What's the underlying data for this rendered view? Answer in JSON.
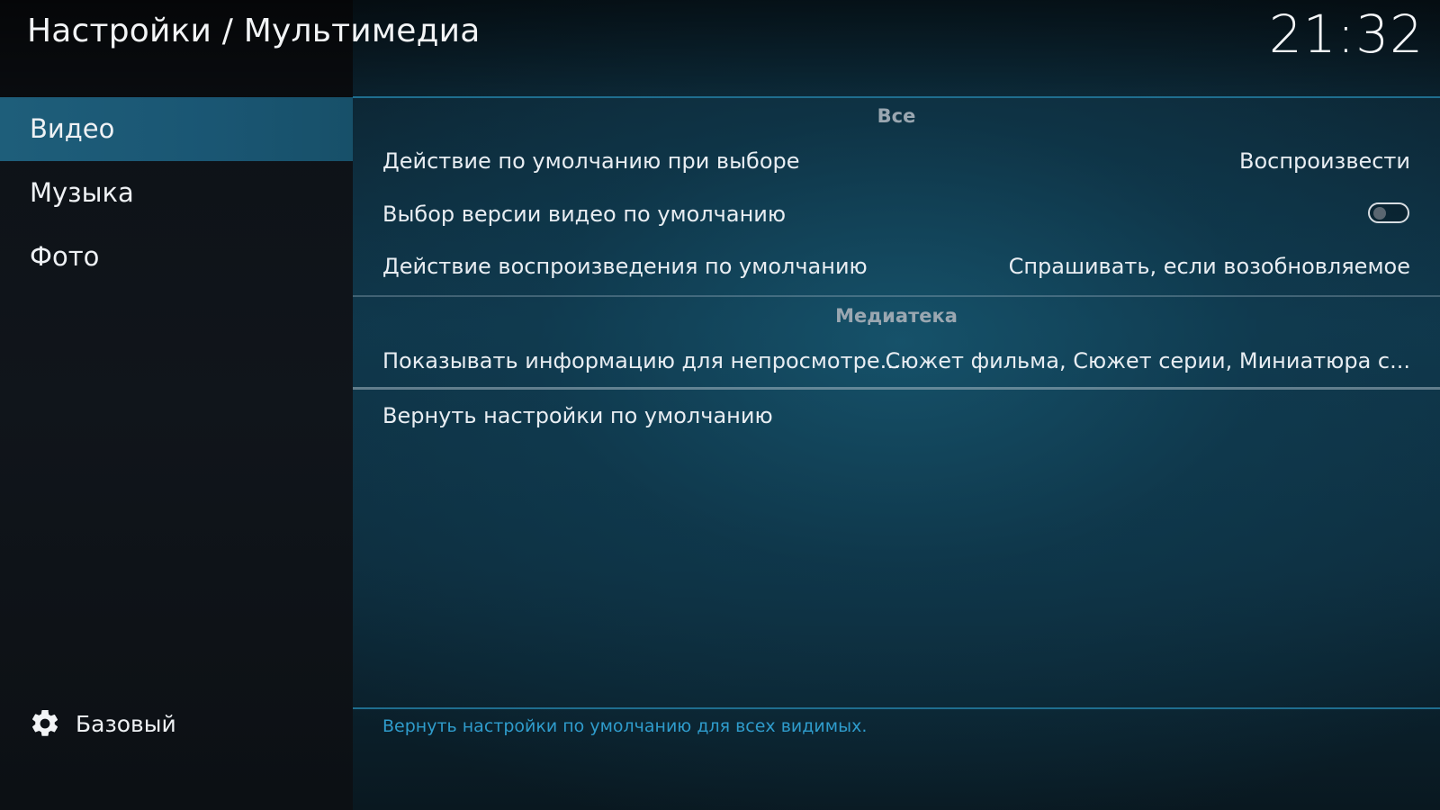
{
  "header": {
    "title": "Настройки / Мультимедиа",
    "clock": "21:32"
  },
  "sidebar": {
    "items": [
      {
        "label": "Видео",
        "active": true
      },
      {
        "label": "Музыка",
        "active": false
      },
      {
        "label": "Фото",
        "active": false
      }
    ],
    "footer": {
      "icon": "gear-icon",
      "label": "Базовый"
    }
  },
  "content": {
    "groups": [
      {
        "title": "Все",
        "settings": [
          {
            "label": "Действие по умолчанию при выборе",
            "value": "Воспроизвести"
          },
          {
            "label": "Выбор версии видео по умолчанию",
            "toggle": false
          },
          {
            "label": "Действие воспроизведения по умолчанию",
            "value": "Спрашивать, если возобновляемое"
          }
        ]
      },
      {
        "title": "Медиатека",
        "settings": [
          {
            "label": "Показывать информацию для непросмотре...",
            "value": "Сюжет фильма, Сюжет серии, Миниатюра с..."
          }
        ]
      }
    ],
    "reset_label": "Вернуть настройки по умолчанию",
    "help_text": "Вернуть настройки по умолчанию для всех видимых."
  },
  "colors": {
    "accent": "#1f6e8f",
    "active_item": "#1e5e7a",
    "help_text": "#2f9ccc"
  }
}
